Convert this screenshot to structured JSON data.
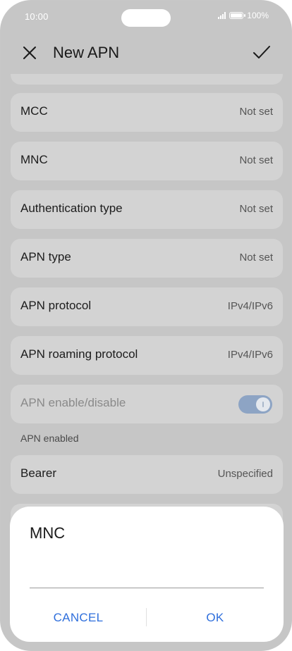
{
  "status_bar": {
    "time": "10:00",
    "battery_text": "100%",
    "signal_icon": "signal-icon",
    "battery_icon": "battery-icon"
  },
  "header": {
    "title": "New APN",
    "close_icon": "close-icon",
    "confirm_icon": "check-icon"
  },
  "settings": [
    {
      "label": "MCC",
      "value": "Not set"
    },
    {
      "label": "MNC",
      "value": "Not set"
    },
    {
      "label": "Authentication type",
      "value": "Not set"
    },
    {
      "label": "APN type",
      "value": "Not set"
    },
    {
      "label": "APN protocol",
      "value": "IPv4/IPv6"
    },
    {
      "label": "APN roaming protocol",
      "value": "IPv4/IPv6"
    }
  ],
  "apn_toggle": {
    "label": "APN enable/disable",
    "enabled": true,
    "note": "APN enabled"
  },
  "bearer": {
    "label": "Bearer",
    "value": "Unspecified"
  },
  "dialog": {
    "title": "MNC",
    "input_value": "",
    "cancel_label": "CANCEL",
    "ok_label": "OK"
  },
  "colors": {
    "accent": "#2f6fdc",
    "background": "#c6c6c6",
    "row": "#d3d3d3",
    "dialog": "#ffffff"
  }
}
